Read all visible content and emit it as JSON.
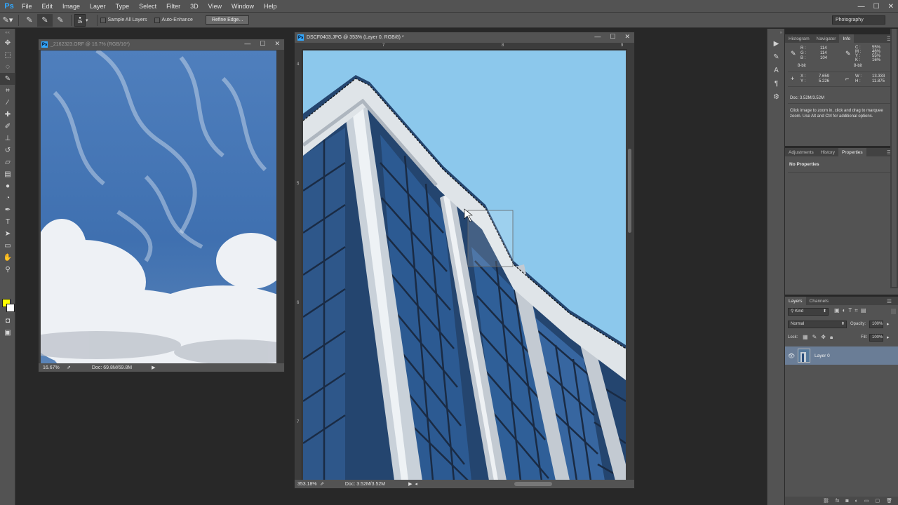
{
  "app": {
    "logo": "Ps"
  },
  "menu": [
    "File",
    "Edit",
    "Image",
    "Layer",
    "Type",
    "Select",
    "Filter",
    "3D",
    "View",
    "Window",
    "Help"
  ],
  "window_controls": {
    "minimize": "—",
    "maximize": "☐",
    "close": "✕"
  },
  "options": {
    "brush_size": "35",
    "sample_all_layers": "Sample All Layers",
    "auto_enhance": "Auto-Enhance",
    "refine_edge": "Refine Edge...",
    "workspace": "Photography"
  },
  "doc1": {
    "title": "_2162323.ORF @ 16.7% (RGB/16*)",
    "zoom": "16.67%",
    "doc_size": "Doc: 69.8M/69.8M"
  },
  "doc2": {
    "title": "DSCF0403.JPG @ 353% (Layer 0, RGB/8) *",
    "zoom": "353.18%",
    "doc_size": "Doc: 3.52M/3.52M",
    "ruler_h": [
      "7",
      "8",
      "9"
    ],
    "ruler_v": [
      "4",
      "5",
      "6",
      "7"
    ]
  },
  "info_panel": {
    "tabs": [
      "Histogram",
      "Navigator",
      "Info"
    ],
    "active_tab": "Info",
    "rgb": {
      "R": "114",
      "G": "114",
      "B": "104"
    },
    "cmyk": {
      "C": "55%",
      "M": "46%",
      "Y": "55%",
      "K": "16%"
    },
    "bit_left": "8-bit",
    "bit_right": "8-bit",
    "xy": {
      "X": "7.659",
      "Y": "5.226"
    },
    "wh": {
      "W": "13.333",
      "H": "11.875"
    },
    "doc": "Doc: 3.52M/3.52M",
    "help": "Click image to zoom in, click and drag to marquee zoom. Use Alt and Ctrl for additional options."
  },
  "props_panel": {
    "tabs": [
      "Adjustments",
      "History",
      "Properties"
    ],
    "active_tab": "Properties",
    "content": "No Properties"
  },
  "layers_panel": {
    "tabs": [
      "Layers",
      "Channels"
    ],
    "active_tab": "Layers",
    "filter": "Kind",
    "blend_mode": "Normal",
    "opacity_label": "Opacity:",
    "opacity": "100%",
    "lock_label": "Lock:",
    "fill_label": "Fill:",
    "fill": "100%",
    "layer_name": "Layer 0"
  },
  "colors": {
    "foreground": "#ffff00",
    "background": "#ffffff",
    "accent": "#31a8ff"
  }
}
